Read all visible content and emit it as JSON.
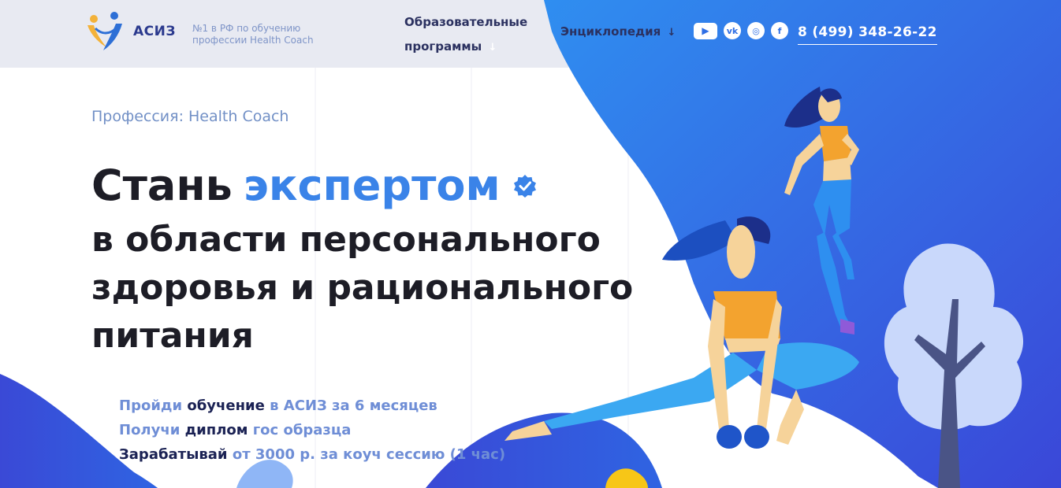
{
  "header": {
    "logo_text": "АСИЗ",
    "tagline": "№1 в РФ по обучению профессии Health Coach",
    "nav": {
      "programs_label": "Образовательные программы",
      "programs_arrow": "↓",
      "encyclopedia_label": "Энциклопедия",
      "encyclopedia_arrow": "↓"
    },
    "social": [
      {
        "name": "youtube-icon",
        "glyph": "▶"
      },
      {
        "name": "vk-icon",
        "glyph": "vk"
      },
      {
        "name": "instagram-icon",
        "glyph": "◎"
      },
      {
        "name": "facebook-icon",
        "glyph": "f"
      }
    ],
    "phone": "8 (499) 348-26-22"
  },
  "hero": {
    "profession": "Профессия: Health Coach",
    "title_word": "Стань",
    "title_accent": "экспертом",
    "title_line2": "в области персонального",
    "title_line3": "здоровья и рационального",
    "title_line4": "питания"
  },
  "bullets": {
    "b1_a": "Пройди",
    "b1_b": "обучение",
    "b1_c": "в АСИЗ за 6 месяцев",
    "b2_a": "Получи",
    "b2_b": "диплом",
    "b2_c": "гос образца",
    "b3_a": "Зарабатывай",
    "b3_b": "от 3000 р. за коуч сессию (1 час)"
  },
  "colors": {
    "accent_blue": "#3a83e8",
    "header_bg": "#e8eaf2",
    "dark_text": "#1d1d26",
    "light_blue_text": "#7290c6"
  }
}
